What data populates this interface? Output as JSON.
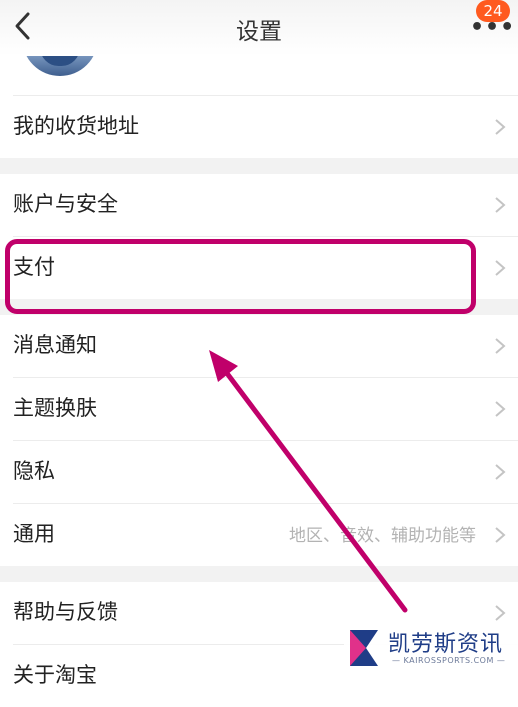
{
  "header": {
    "title": "设置",
    "badge_count": "24",
    "more_icon": "more-dots-icon",
    "back_icon": "chevron-left-icon"
  },
  "groups": [
    {
      "items": [
        {
          "label": "我的收货地址"
        }
      ]
    },
    {
      "items": [
        {
          "label": "账户与安全"
        },
        {
          "label": "支付"
        }
      ]
    },
    {
      "items": [
        {
          "label": "消息通知"
        },
        {
          "label": "主题换肤"
        },
        {
          "label": "隐私"
        },
        {
          "label": "通用",
          "hint": "地区、音效、辅助功能等"
        }
      ]
    },
    {
      "items": [
        {
          "label": "帮助与反馈"
        },
        {
          "label": "关于淘宝"
        }
      ]
    }
  ],
  "annotation": {
    "color": "#c0006a"
  },
  "watermark": {
    "title": "凯劳斯资讯",
    "subtitle": "— KAIROSSPORTS.COM —"
  },
  "colors": {
    "badge": "#ff5a1f",
    "separator": "#f2f2f2",
    "hint_text": "#b3b3b3",
    "watermark_text": "#1f3d87"
  }
}
